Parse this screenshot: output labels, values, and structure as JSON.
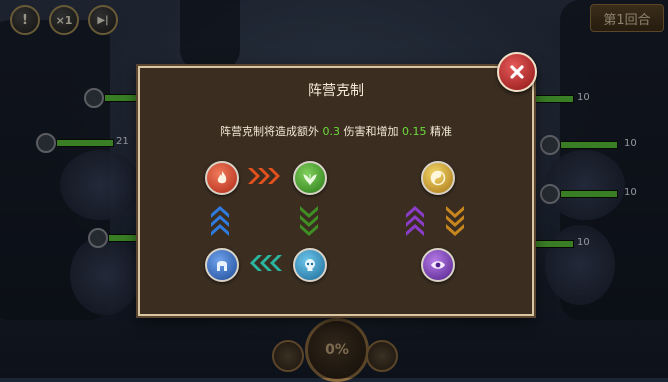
{
  "top_controls": {
    "alert_glyph": "!",
    "speed_glyph": "×1",
    "skip_glyph": "▶|",
    "round_label": "第1回合"
  },
  "battle": {
    "hp_numbers": [
      "10",
      "10",
      "10",
      "10",
      "21"
    ],
    "energy_label": "0%"
  },
  "dialog": {
    "title": "阵营克制",
    "desc_prefix": "阵营克制将造成额外 ",
    "bonus_damage": "0.3",
    "desc_middle": " 伤害和增加 ",
    "bonus_accuracy": "0.15",
    "desc_suffix": " 精准"
  },
  "factions": {
    "fire": {
      "icon": "flame-icon",
      "color": "#d9432c"
    },
    "nature": {
      "icon": "leaf-icon",
      "color": "#3f9a2c"
    },
    "light": {
      "icon": "yin-yang-icon",
      "color": "#d8a92a"
    },
    "spartan": {
      "icon": "helmet-icon",
      "color": "#2b63b8"
    },
    "ice": {
      "icon": "skull-icon",
      "color": "#2e8ab8"
    },
    "shadow": {
      "icon": "eye-icon",
      "color": "#7a3bb6"
    }
  },
  "colors": {
    "arrow_fire": "#e4501e",
    "arrow_blue": "#2f7be0",
    "arrow_green": "#3f8f24",
    "arrow_teal": "#2bb6a2",
    "arrow_purple": "#8b3cc9",
    "arrow_gold": "#c8861e"
  }
}
